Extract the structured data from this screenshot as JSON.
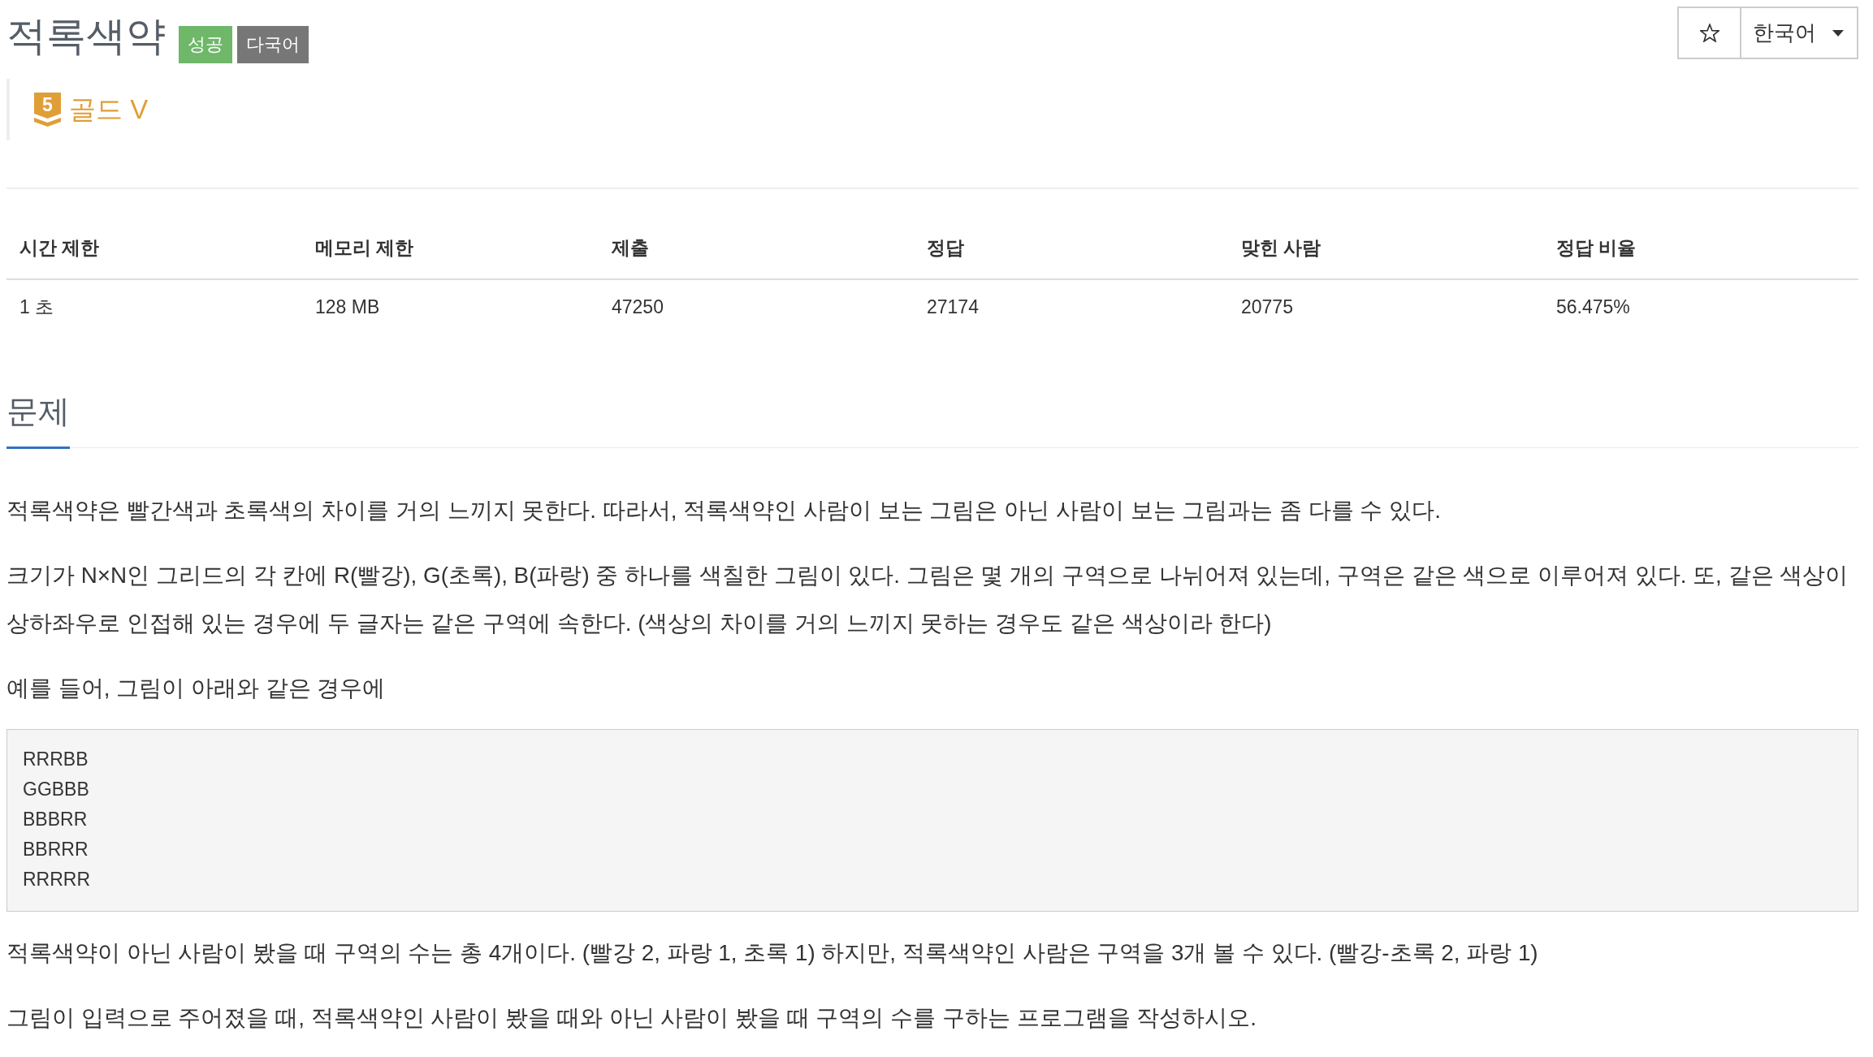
{
  "header": {
    "title": "적록색약",
    "badges": [
      {
        "kind": "success",
        "label": "성공"
      },
      {
        "kind": "language",
        "label": "다국어"
      }
    ],
    "tier": {
      "number": "5",
      "label": "골드 V"
    }
  },
  "actions": {
    "favorite": {
      "starred": false
    },
    "language": {
      "value": "한국어"
    }
  },
  "info_table": {
    "columns": [
      "시간 제한",
      "메모리 제한",
      "제출",
      "정답",
      "맞힌 사람",
      "정답 비율"
    ],
    "rows": [
      [
        "1 초",
        "128 MB",
        "47250",
        "27174",
        "20775",
        "56.475%"
      ]
    ]
  },
  "section": {
    "heading": "문제",
    "content": [
      {
        "kind": "paragraph",
        "text": "적록색약은 빨간색과 초록색의 차이를 거의 느끼지 못한다. 따라서, 적록색약인 사람이 보는 그림은 아닌 사람이 보는 그림과는 좀 다를 수 있다."
      },
      {
        "kind": "paragraph",
        "text": "크기가 N×N인 그리드의 각 칸에 R(빨강), G(초록), B(파랑) 중 하나를 색칠한 그림이 있다. 그림은 몇 개의 구역으로 나뉘어져 있는데, 구역은 같은 색으로 이루어져 있다. 또, 같은 색상이 상하좌우로 인접해 있는 경우에 두 글자는 같은 구역에 속한다. (색상의 차이를 거의 느끼지 못하는 경우도 같은 색상이라 한다)"
      },
      {
        "kind": "paragraph",
        "text": "예를 들어, 그림이 아래와 같은 경우에"
      },
      {
        "kind": "code",
        "lines": [
          "RRRBB",
          "GGBBB",
          "BBBRR",
          "BBRRR",
          "RRRRR"
        ]
      },
      {
        "kind": "paragraph",
        "text": "적록색약이 아닌 사람이 봤을 때 구역의 수는 총 4개이다. (빨강 2, 파랑 1, 초록 1) 하지만, 적록색약인 사람은 구역을 3개 볼 수 있다. (빨강-초록 2, 파랑 1)"
      },
      {
        "kind": "paragraph",
        "text": "그림이 입력으로 주어졌을 때, 적록색약인 사람이 봤을 때와 아닌 사람이 봤을 때 구역의 수를 구하는 프로그램을 작성하시오."
      }
    ]
  }
}
